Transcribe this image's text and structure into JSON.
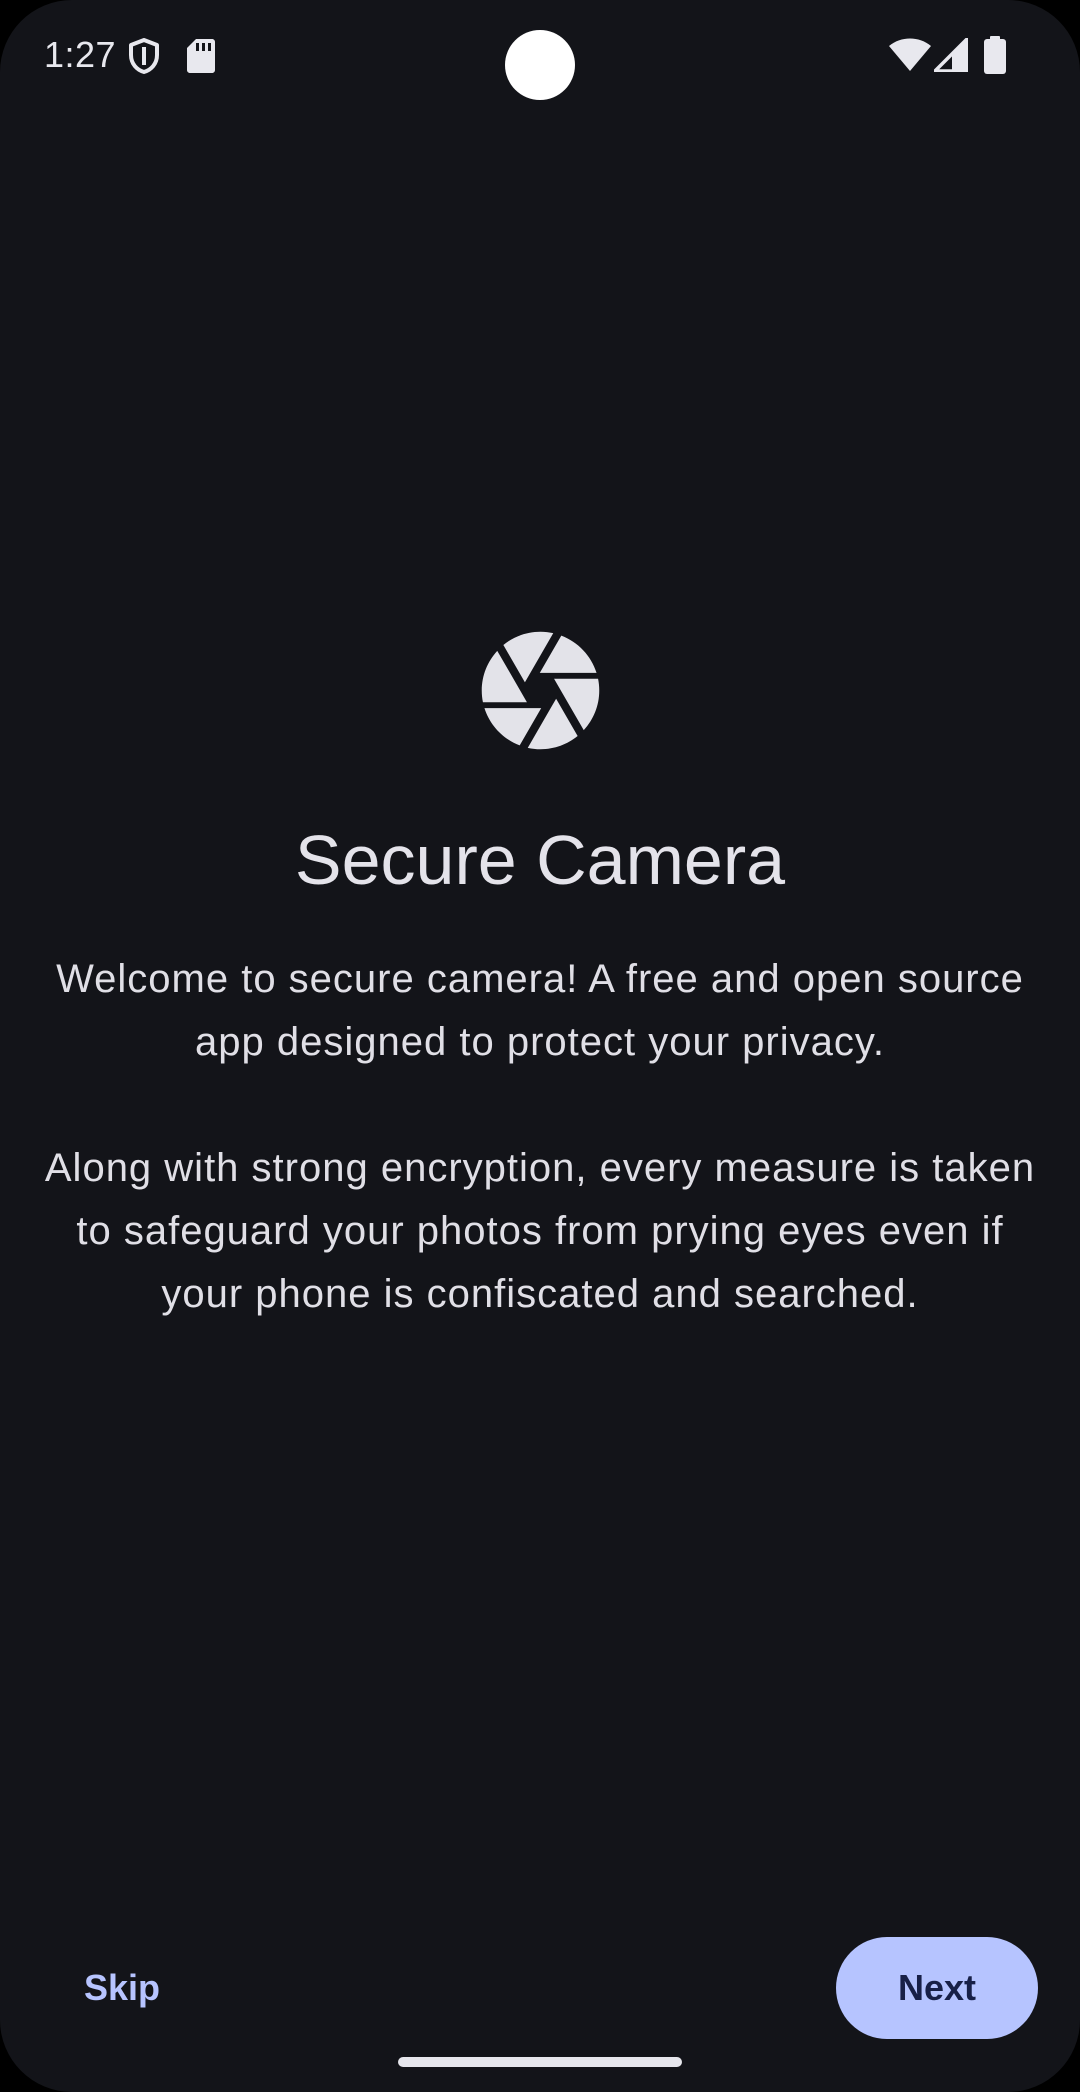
{
  "status_bar": {
    "time": "1:27",
    "icons": [
      "shield-icon",
      "sd-card-icon",
      "wifi-icon",
      "cell-signal-icon",
      "battery-icon"
    ]
  },
  "app": {
    "logo_icon": "aperture-icon",
    "title": "Secure Camera",
    "paragraphs": [
      "Welcome to secure camera! A free and open source app designed to protect your privacy.",
      "Along with strong encryption, every measure is taken to safeguard your photos from prying eyes even if your phone is confiscated and searched."
    ]
  },
  "actions": {
    "skip_label": "Skip",
    "next_label": "Next"
  },
  "colors": {
    "background": "#131419",
    "accent": "#b6c4ff",
    "on_accent": "#182047",
    "text": "#e4e3ea"
  }
}
